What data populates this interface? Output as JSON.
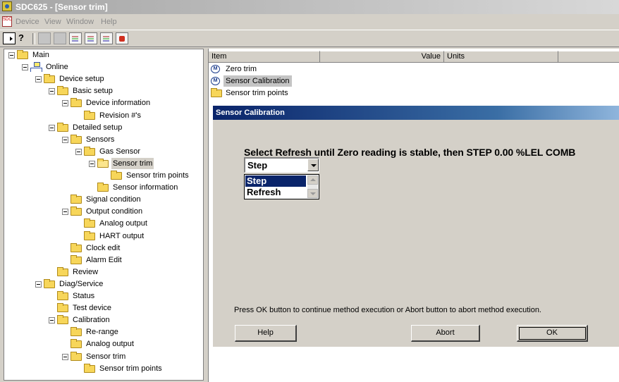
{
  "window": {
    "title": "SDC625 - [Sensor trim]"
  },
  "menu": [
    "Device",
    "View",
    "Window",
    "Help"
  ],
  "toolbar": {
    "buttons": [
      "new-icon",
      "help-icon",
      "toolbar-icon-1",
      "toolbar-icon-2",
      "toolbar-icon-3",
      "toolbar-icon-4",
      "toolbar-icon-5",
      "toolbar-icon-6"
    ]
  },
  "tree": [
    {
      "label": "Main",
      "depth": 0,
      "icon": "folder",
      "expanded": true
    },
    {
      "label": "Online",
      "depth": 1,
      "icon": "network",
      "expanded": true
    },
    {
      "label": "Device setup",
      "depth": 2,
      "icon": "folder",
      "expanded": true
    },
    {
      "label": "Basic setup",
      "depth": 3,
      "icon": "folder",
      "expanded": true
    },
    {
      "label": "Device information",
      "depth": 4,
      "icon": "folder",
      "expanded": true
    },
    {
      "label": "Revision #'s",
      "depth": 5,
      "icon": "folder"
    },
    {
      "label": "Detailed setup",
      "depth": 3,
      "icon": "folder",
      "expanded": true
    },
    {
      "label": "Sensors",
      "depth": 4,
      "icon": "folder",
      "expanded": true
    },
    {
      "label": "Gas Sensor",
      "depth": 5,
      "icon": "folder",
      "expanded": true
    },
    {
      "label": "Sensor trim",
      "depth": 6,
      "icon": "folder-open",
      "expanded": true,
      "selected": true
    },
    {
      "label": "Sensor trim points",
      "depth": 7,
      "icon": "folder"
    },
    {
      "label": "Sensor information",
      "depth": 6,
      "icon": "folder"
    },
    {
      "label": "Signal condition",
      "depth": 4,
      "icon": "folder"
    },
    {
      "label": "Output condition",
      "depth": 4,
      "icon": "folder",
      "expanded": true
    },
    {
      "label": "Analog output",
      "depth": 5,
      "icon": "folder"
    },
    {
      "label": "HART output",
      "depth": 5,
      "icon": "folder"
    },
    {
      "label": "Clock edit",
      "depth": 4,
      "icon": "folder"
    },
    {
      "label": "Alarm Edit",
      "depth": 4,
      "icon": "folder"
    },
    {
      "label": "Review",
      "depth": 3,
      "icon": "folder"
    },
    {
      "label": "Diag/Service",
      "depth": 2,
      "icon": "folder",
      "expanded": true
    },
    {
      "label": "Status",
      "depth": 3,
      "icon": "folder"
    },
    {
      "label": "Test device",
      "depth": 3,
      "icon": "folder"
    },
    {
      "label": "Calibration",
      "depth": 3,
      "icon": "folder",
      "expanded": true
    },
    {
      "label": "Re-range",
      "depth": 4,
      "icon": "folder"
    },
    {
      "label": "Analog output",
      "depth": 4,
      "icon": "folder"
    },
    {
      "label": "Sensor trim",
      "depth": 4,
      "icon": "folder",
      "expanded": true
    },
    {
      "label": "Sensor trim points",
      "depth": 5,
      "icon": "folder"
    }
  ],
  "list": {
    "columns": [
      "Item",
      "Value",
      "Units"
    ],
    "items": [
      {
        "label": "Zero trim",
        "icon": "method"
      },
      {
        "label": "Sensor Calibration",
        "icon": "method",
        "selected": true
      },
      {
        "label": "Sensor trim points",
        "icon": "folder"
      }
    ]
  },
  "dialog": {
    "title": "Sensor Calibration",
    "prompt": "Select Refresh until Zero reading is stable, then STEP  0.00 %LEL  COMB",
    "combo_value": "Step",
    "options": [
      "Step",
      "Refresh"
    ],
    "selected_option": "Step",
    "note": "Press OK button to continue method execution or Abort button to abort method execution.",
    "buttons": {
      "help": "Help",
      "abort": "Abort",
      "ok": "OK"
    }
  }
}
